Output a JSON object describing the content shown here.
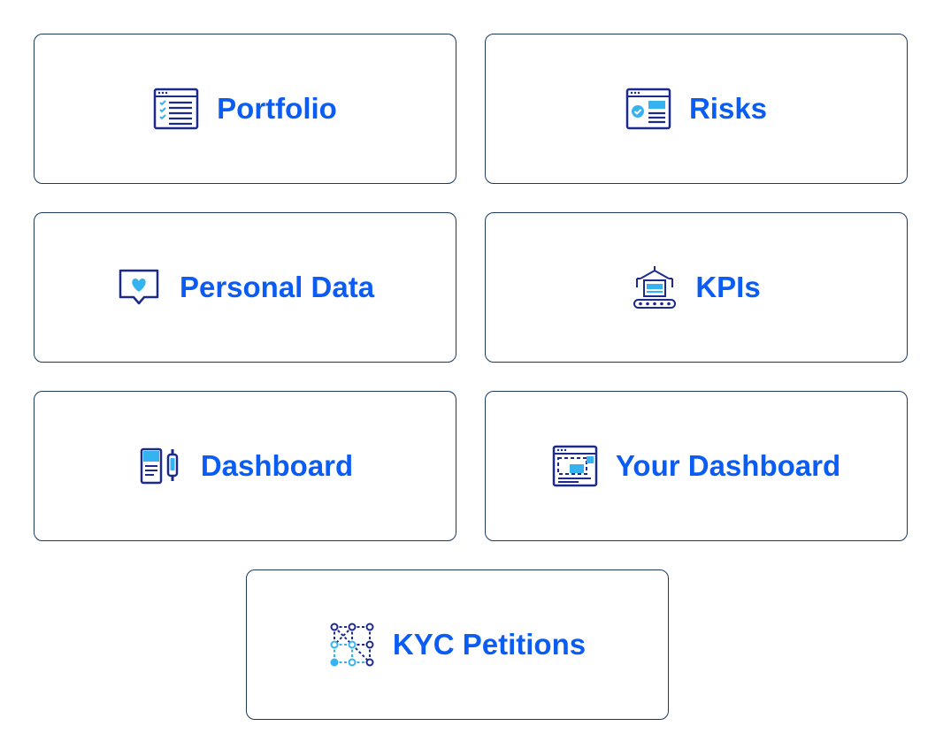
{
  "colors": {
    "label": "#0a5cf5",
    "icon_dark": "#1b2a8c",
    "icon_light": "#35b3f0",
    "border": "#1b3a5c"
  },
  "cards": [
    {
      "label": "Portfolio",
      "icon": "checklist-document-icon"
    },
    {
      "label": "Risks",
      "icon": "browser-check-icon"
    },
    {
      "label": "Personal Data",
      "icon": "heart-speech-bubble-icon"
    },
    {
      "label": "KPIs",
      "icon": "conveyor-belt-box-icon"
    },
    {
      "label": "Dashboard",
      "icon": "phone-watch-icon"
    },
    {
      "label": "Your Dashboard",
      "icon": "browser-selection-icon"
    },
    {
      "label": "KYC Petitions",
      "icon": "node-network-icon"
    }
  ]
}
